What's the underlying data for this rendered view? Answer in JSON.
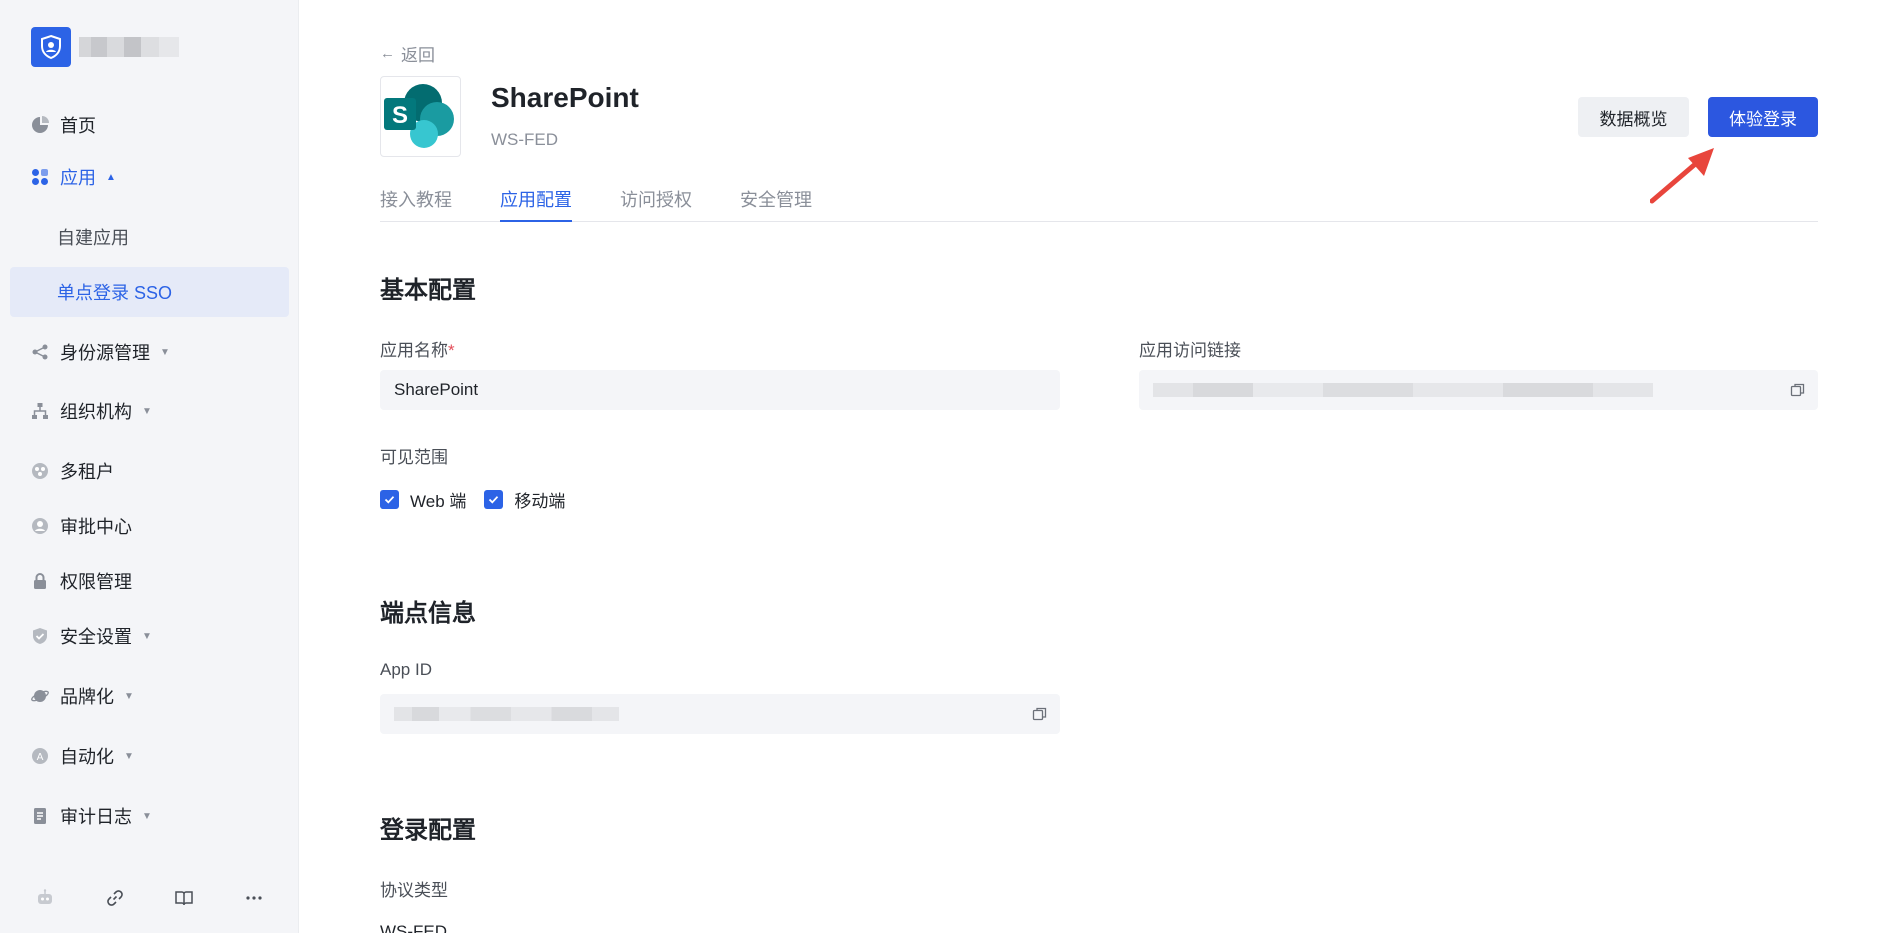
{
  "sidebar": {
    "brand_name": "",
    "items": [
      {
        "label": "首页"
      },
      {
        "label": "应用"
      },
      {
        "label": "自建应用"
      },
      {
        "label": "单点登录 SSO"
      },
      {
        "label": "身份源管理"
      },
      {
        "label": "组织机构"
      },
      {
        "label": "多租户"
      },
      {
        "label": "审批中心"
      },
      {
        "label": "权限管理"
      },
      {
        "label": "安全设置"
      },
      {
        "label": "品牌化"
      },
      {
        "label": "自动化"
      },
      {
        "label": "审计日志"
      }
    ],
    "tools": [
      "robot-icon",
      "link-icon",
      "book-icon",
      "more-icon"
    ]
  },
  "header": {
    "back_label": "返回",
    "app_title": "SharePoint",
    "app_protocol": "WS-FED",
    "overview_button": "数据概览",
    "try_login_button": "体验登录"
  },
  "tabs": [
    {
      "label": "接入教程"
    },
    {
      "label": "应用配置"
    },
    {
      "label": "访问授权"
    },
    {
      "label": "安全管理"
    }
  ],
  "basic": {
    "title": "基本配置",
    "app_name_label": "应用名称",
    "required_mark": "*",
    "app_name_value": "SharePoint",
    "access_link_label": "应用访问链接",
    "visibility_label": "可见范围",
    "web_label": "Web 端",
    "mobile_label": "移动端"
  },
  "endpoint": {
    "title": "端点信息",
    "app_id_label": "App ID"
  },
  "login": {
    "title": "登录配置",
    "protocol_label": "协议类型",
    "protocol_value": "WS-FED"
  },
  "colors": {
    "primary": "#2c57e0",
    "accent": "#2c63e6",
    "sidebar_bg": "#f4f5f8",
    "annotation": "#e8453c"
  }
}
